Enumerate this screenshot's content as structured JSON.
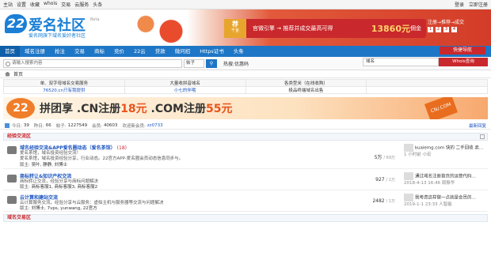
{
  "topbar": {
    "links": [
      "主站",
      "设置",
      "收藏",
      "whois",
      "交易",
      "云服务",
      "头条"
    ],
    "login": "登录",
    "register": "立即注册"
  },
  "logo": {
    "num": "22",
    "name": "爱名社区",
    "beta": "Beta",
    "slogan": "爱名网旗下域名爱好者社区"
  },
  "banner": {
    "badge_top": "荐",
    "badge_bottom": "千金",
    "text": "官微引擎 → 推荐并成交最高可得",
    "amount": "13860元",
    "tail": "佣金"
  },
  "sidead": {
    "row1": "注册→推荐→成交",
    "row2": [
      "1",
      "2",
      "3",
      "4"
    ]
  },
  "nav": {
    "items": [
      "首页",
      "域名注册",
      "抢注",
      "交易",
      "商标",
      "竞价",
      "22云",
      "贷款",
      "微问招",
      "Https证书",
      "头条"
    ]
  },
  "search": {
    "placeholder": "请输入搜索内容",
    "select": "帖子",
    "button": "",
    "hot_label": "热搜:",
    "hot_value": "优惠码"
  },
  "rightsearch": {
    "placeholder": "域名",
    "button": "Whois查询"
  },
  "quicknav": "快捷导航",
  "crumb": {
    "home": "首页"
  },
  "services": {
    "headers": [
      "单、双字母域名交易服务",
      "大量收拼音域名",
      "各类型米（在线收购）",
      ""
    ],
    "values": [
      "76520.cn只有我提供",
      "小七的伴哦",
      "极品终端域名出售",
      ""
    ]
  },
  "ad": {
    "num": "22",
    "text1": "拼团享 .CN注册",
    "price1": "18元",
    "text2": " .COM注册",
    "price2": "55元",
    "badge": "CN/.COM"
  },
  "stats": {
    "today_label": "今日:",
    "today": "39",
    "yesterday_label": "昨日:",
    "yesterday": "66",
    "posts_label": "帖子:",
    "posts": "1227549",
    "members_label": "会员:",
    "members": "40603",
    "newest_label": "欢迎新会员:",
    "newest": "zz0733",
    "new_link": "最新回复"
  },
  "section1": {
    "title": "经验交流区"
  },
  "forums": [
    {
      "title": "域名经验交流&APP爱名圈动态（爱名茶馆）",
      "count": "(18)",
      "desc": "爱名茶馆，域名投资经验交流！",
      "desc2": "爱名茶馆，域名投资经验分享，行业动态。22官方APP-爱名圈会员动态信息同步与。",
      "mods_label": "版主:",
      "mods": "吴叶, 静静, 刘博士",
      "stat": "5万",
      "stat_sub": "/ 69万",
      "last1": "kuaiemg.com 快的 二手回收 卖…",
      "last2": "1 小时前 小宏"
    },
    {
      "title": "商标转让&知识产权交流",
      "count": "",
      "desc": "商标转让交流，经验分享与商标问题解决",
      "desc2": "",
      "mods_label": "版主:",
      "mods": "商标客服1, 商标客服3, 商标客服2",
      "stat": "927",
      "stat_sub": "/ 1万",
      "last1": "通过域名注册首页的运营代码…",
      "last2": "2018-4-13 16:46 周振华"
    },
    {
      "title": "云计算和建站交流",
      "count": "",
      "desc": "云计算服务交流，经验分享与云服务：虚拟主机与服务器等交流与问题解决",
      "desc2": "",
      "mods_label": "版主:",
      "mods": "刘博士, 7vps, yunwang, 22官方",
      "stat": "2482",
      "stat_sub": "/ 1万",
      "last1": "我考虑这样做一点就是会员的…",
      "last2": "2019-1-1 23:33 人智能"
    }
  ],
  "section2": {
    "title": "域名交易区"
  },
  "bottom": {
    "title": "域名交易区"
  }
}
